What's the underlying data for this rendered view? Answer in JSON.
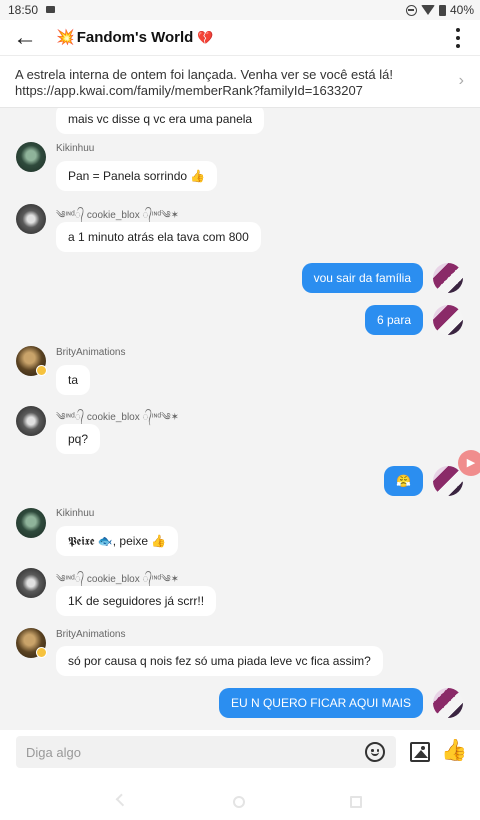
{
  "status_bar": {
    "time": "18:50",
    "battery": "40%"
  },
  "header": {
    "title": "Fandom's World",
    "title_icon": "collision-icon",
    "title_heart": "heart-icon",
    "back_icon": "arrow-left-icon",
    "more_icon": "more-vertical-icon"
  },
  "announcement": {
    "line1": "A estrela interna de ontem foi lançada. Venha ver se você está lá!",
    "line2": "https://app.kwai.com/family/memberRank?familyId=1633207",
    "arrow_icon": "chevron-right-icon"
  },
  "messages": [
    {
      "kind": "in",
      "sender": "",
      "avatar": "",
      "text": "mais vc disse q vc era uma panela"
    },
    {
      "kind": "in",
      "sender": "Kikinhuu",
      "avatar": "green",
      "text": "Pan = Panela sorrindo 👍"
    },
    {
      "kind": "in",
      "sender": "༄ᶦᶰᵈ᭄ cookie_blox ᭄ᶦᶰᵈ༄✶",
      "avatar": "cookie",
      "text": "a 1 minuto atrás ela tava com 800"
    },
    {
      "kind": "out",
      "text": "vou sair da família"
    },
    {
      "kind": "out",
      "text": "6 para"
    },
    {
      "kind": "in",
      "sender": "BrityAnimations",
      "avatar": "brity",
      "text": "ta"
    },
    {
      "kind": "in",
      "sender": "༄ᶦᶰᵈ᭄ cookie_blox ᭄ᶦᶰᵈ༄✶",
      "avatar": "cookie",
      "text": "pq?"
    },
    {
      "kind": "out",
      "text": "😤"
    },
    {
      "kind": "in",
      "sender": "Kikinhuu",
      "avatar": "green",
      "text": "𝕻𝖊𝖎𝖝𝖊 🐟, peixe 👍"
    },
    {
      "kind": "in",
      "sender": "༄ᶦᶰᵈ᭄ cookie_blox ᭄ᶦᶰᵈ༄✶",
      "avatar": "cookie",
      "text": "1K de seguidores já scrr!!"
    },
    {
      "kind": "in",
      "sender": "BrityAnimations",
      "avatar": "brity",
      "text": "só por causa q nois fez só uma piada leve vc fica assim?"
    },
    {
      "kind": "out",
      "text": "EU N QUERO FICAR AQUI MAIS"
    }
  ],
  "input": {
    "placeholder": "Diga algo",
    "emoji_icon": "smiley-icon",
    "image_icon": "image-icon",
    "like_icon": "thumbs-up-icon"
  },
  "colors": {
    "outgoing_bubble": "#2b8ef0",
    "incoming_bubble": "#ffffff",
    "chat_background": "#f3f3f3",
    "record_button": "#f08d8d"
  }
}
